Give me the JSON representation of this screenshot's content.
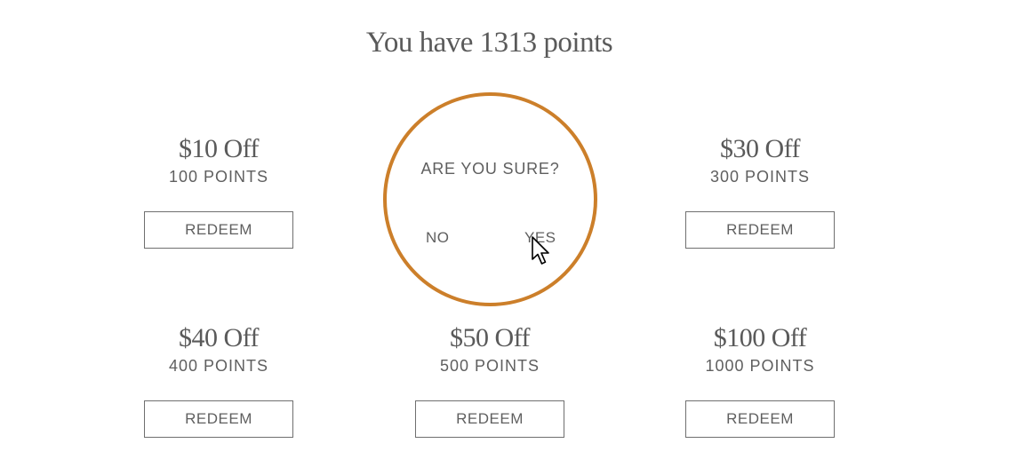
{
  "header": {
    "title": "You have 1313 points"
  },
  "rewards": [
    {
      "amount": "$10 Off",
      "points": "100 POINTS",
      "button_label": "REDEEM"
    },
    {
      "amount": "$30 Off",
      "points": "300 POINTS",
      "button_label": "REDEEM"
    },
    {
      "amount": "$40 Off",
      "points": "400 POINTS",
      "button_label": "REDEEM"
    },
    {
      "amount": "$50 Off",
      "points": "500 POINTS",
      "button_label": "REDEEM"
    },
    {
      "amount": "$100 Off",
      "points": "1000 POINTS",
      "button_label": "REDEEM"
    }
  ],
  "confirm": {
    "question": "ARE YOU SURE?",
    "no_label": "NO",
    "yes_label": "YES"
  },
  "colors": {
    "accent": "#cc7f2a",
    "text": "#5f5f5f",
    "border": "#6f6f6f"
  },
  "icons": {
    "cursor": "mouse-pointer-icon"
  }
}
